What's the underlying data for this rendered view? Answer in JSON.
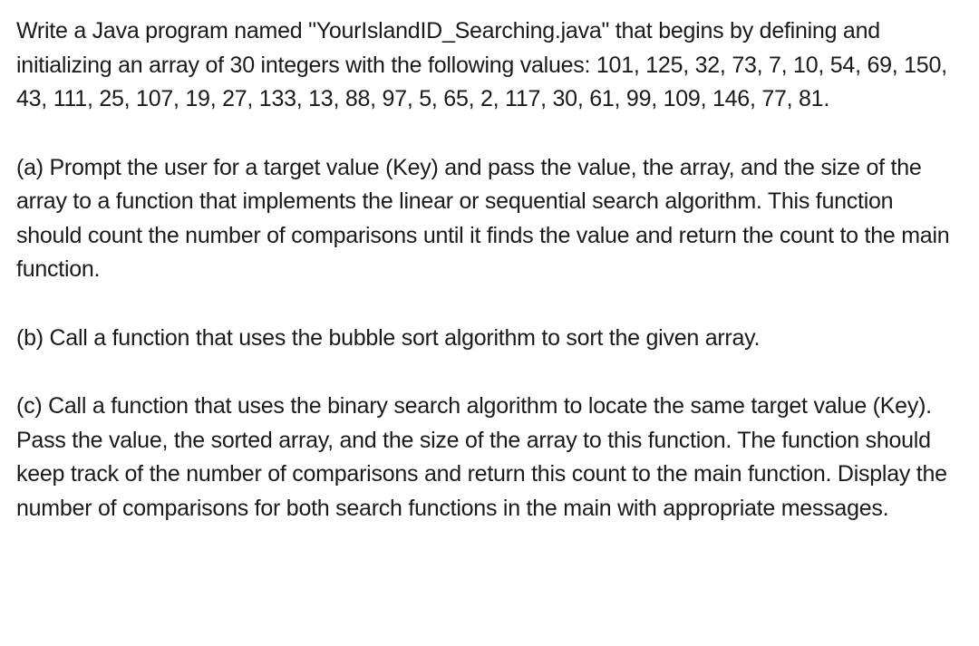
{
  "intro": "Write a Java program named \"YourIslandID_Searching.java\" that begins by defining and initializing an array of 30 integers with the following values: 101, 125, 32, 73, 7, 10, 54, 69, 150, 43, 111, 25, 107, 19, 27, 133, 13, 88, 97, 5, 65, 2, 117, 30, 61, 99, 109, 146, 77, 81.",
  "part_a": "(a) Prompt the user for a target value (Key) and pass the value, the array, and the size of the array to a function that implements the linear or sequential search algorithm. This function should count the number of comparisons until it finds the value and return the count to the main function.",
  "part_b": "(b) Call a function that uses the bubble sort algorithm to sort the given array.",
  "part_c": "(c) Call a function that uses the binary search algorithm to locate the same target value (Key). Pass the value, the sorted array, and the size of the array to this function. The function should keep track of the number of comparisons and return this count to the main function. Display the number of comparisons for both search functions in the main with appropriate messages."
}
